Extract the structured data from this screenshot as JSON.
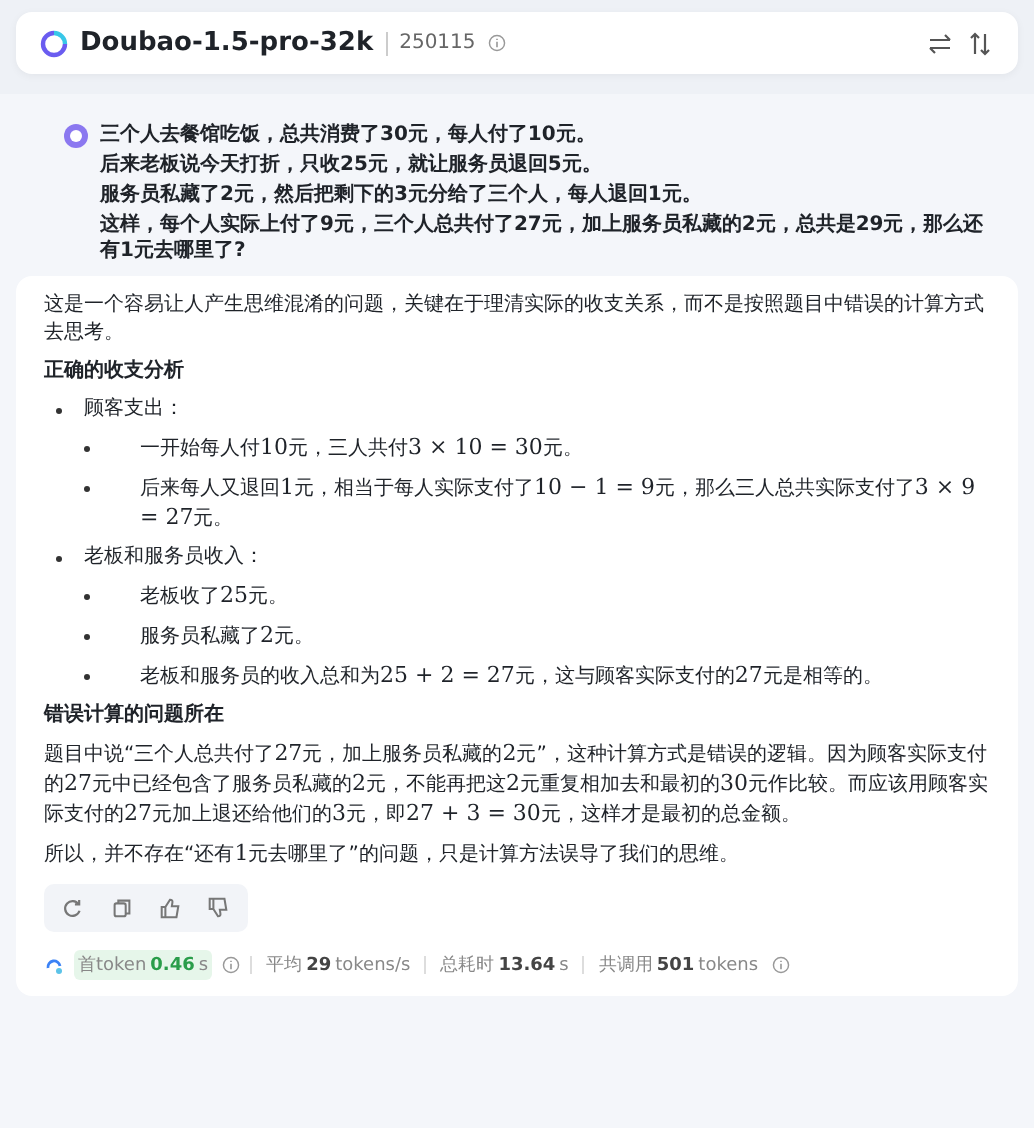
{
  "header": {
    "model_name": "Doubao-1.5-pro-32k",
    "version": "250115"
  },
  "question": {
    "lines": [
      "三个人去餐馆吃饭，总共消费了30元，每人付了10元。",
      "后来老板说今天打折，只收25元，就让服务员退回5元。",
      "服务员私藏了2元，然后把剩下的3元分给了三个人，每人退回1元。",
      "这样，每个人实际上付了9元，三个人总共付了27元，加上服务员私藏的2元，总共是29元，那么还有1元去哪里了?"
    ]
  },
  "answer": {
    "blocks": [
      {
        "kind": "paragraph",
        "parts": [
          {
            "kind": "text",
            "text": "这是一个容易让人产生思维混淆的问题，关键在于理清实际的收支关系，而不是按照题目中错误的计算方式去思考。"
          }
        ]
      },
      {
        "kind": "heading",
        "parts": [
          {
            "kind": "text",
            "text": "正确的收支分析"
          }
        ]
      },
      {
        "kind": "bullet",
        "parts": [
          {
            "kind": "text",
            "text": "顾客支出："
          }
        ]
      },
      {
        "kind": "subbullet",
        "parts": [
          {
            "kind": "text",
            "text": "一开始每人付"
          },
          {
            "kind": "math",
            "text": "10"
          },
          {
            "kind": "text",
            "text": "元，三人共付"
          },
          {
            "kind": "math",
            "text": "3 × 10 = 30"
          },
          {
            "kind": "text",
            "text": "元。"
          }
        ]
      },
      {
        "kind": "subbullet",
        "parts": [
          {
            "kind": "text",
            "text": "后来每人又退回"
          },
          {
            "kind": "math",
            "text": "1"
          },
          {
            "kind": "text",
            "text": "元，相当于每人实际支付了"
          },
          {
            "kind": "math",
            "text": "10 − 1 = 9"
          },
          {
            "kind": "text",
            "text": "元，那么三人总共实际支付了"
          },
          {
            "kind": "math",
            "text": "3 × 9 = 27"
          },
          {
            "kind": "text",
            "text": "元。"
          }
        ]
      },
      {
        "kind": "bullet",
        "parts": [
          {
            "kind": "text",
            "text": "老板和服务员收入："
          }
        ]
      },
      {
        "kind": "subbullet",
        "parts": [
          {
            "kind": "text",
            "text": "老板收了"
          },
          {
            "kind": "math",
            "text": "25"
          },
          {
            "kind": "text",
            "text": "元。"
          }
        ]
      },
      {
        "kind": "subbullet",
        "parts": [
          {
            "kind": "text",
            "text": "服务员私藏了"
          },
          {
            "kind": "math",
            "text": "2"
          },
          {
            "kind": "text",
            "text": "元。"
          }
        ]
      },
      {
        "kind": "subbullet",
        "parts": [
          {
            "kind": "text",
            "text": "老板和服务员的收入总和为"
          },
          {
            "kind": "math",
            "text": "25 + 2 = 27"
          },
          {
            "kind": "text",
            "text": "元，这与顾客实际支付的"
          },
          {
            "kind": "math",
            "text": "27"
          },
          {
            "kind": "text",
            "text": "元是相等的。"
          }
        ]
      },
      {
        "kind": "heading",
        "parts": [
          {
            "kind": "text",
            "text": "错误计算的问题所在"
          }
        ]
      },
      {
        "kind": "paragraph",
        "parts": [
          {
            "kind": "text",
            "text": "题目中说“三个人总共付了"
          },
          {
            "kind": "math",
            "text": "27"
          },
          {
            "kind": "text",
            "text": "元，加上服务员私藏的"
          },
          {
            "kind": "math",
            "text": "2"
          },
          {
            "kind": "text",
            "text": "元”，这种计算方式是错误的逻辑。因为顾客实际支付的"
          },
          {
            "kind": "math",
            "text": "27"
          },
          {
            "kind": "text",
            "text": "元中已经包含了服务员私藏的"
          },
          {
            "kind": "math",
            "text": "2"
          },
          {
            "kind": "text",
            "text": "元，不能再把这"
          },
          {
            "kind": "math",
            "text": "2"
          },
          {
            "kind": "text",
            "text": "元重复相加去和最初的"
          },
          {
            "kind": "math",
            "text": "30"
          },
          {
            "kind": "text",
            "text": "元作比较。而应该用顾客实际支付的"
          },
          {
            "kind": "math",
            "text": "27"
          },
          {
            "kind": "text",
            "text": "元加上退还给他们的"
          },
          {
            "kind": "math",
            "text": "3"
          },
          {
            "kind": "text",
            "text": "元，即"
          },
          {
            "kind": "math",
            "text": "27 + 3 = 30"
          },
          {
            "kind": "text",
            "text": "元，这样才是最初的总金额。"
          }
        ]
      },
      {
        "kind": "paragraph",
        "parts": [
          {
            "kind": "text",
            "text": "所以，并不存在“还有"
          },
          {
            "kind": "math",
            "text": "1"
          },
          {
            "kind": "text",
            "text": "元去哪里了”的问题，只是计算方法误导了我们的思维。"
          }
        ]
      }
    ],
    "actions": [
      {
        "kind": "regenerate"
      },
      {
        "kind": "copy"
      },
      {
        "kind": "like"
      },
      {
        "kind": "dislike"
      }
    ],
    "stats": [
      {
        "label": "首token",
        "value": "0.46",
        "unit": "s",
        "highlight": true,
        "info": true
      },
      {
        "label": "平均",
        "value": "29",
        "unit": "tokens/s",
        "highlight": false,
        "info": false
      },
      {
        "label": "总耗时",
        "value": "13.64",
        "unit": "s",
        "highlight": false,
        "info": false
      },
      {
        "label": "共调用",
        "value": "501",
        "unit": "tokens",
        "highlight": false,
        "info": true
      }
    ]
  }
}
